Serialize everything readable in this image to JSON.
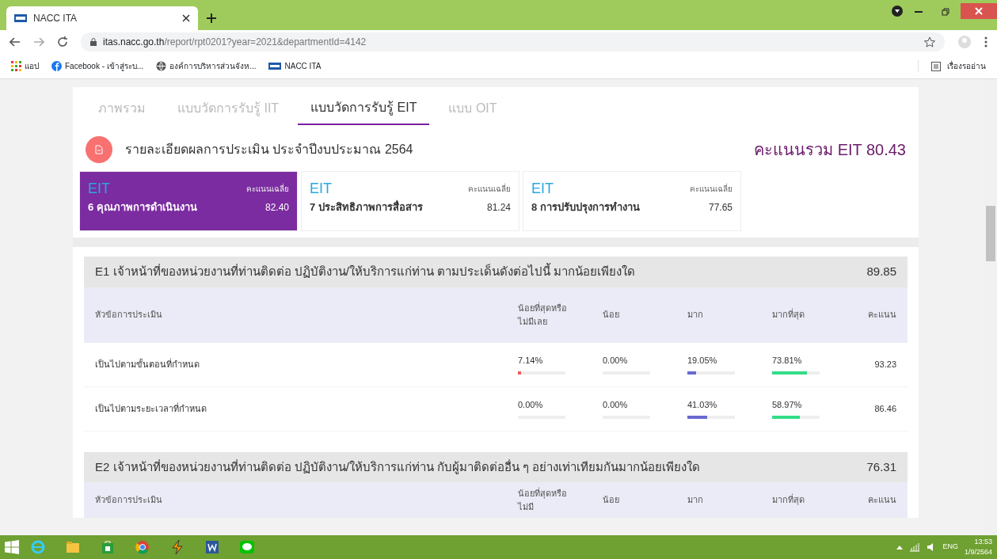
{
  "browser": {
    "tab_title": "NACC ITA",
    "url_host": "itas.nacc.go.th",
    "url_path": "/report/rpt0201?year=2021&departmentId=4142",
    "bookmarks": [
      {
        "kind": "apps",
        "label": "แอป"
      },
      {
        "kind": "facebook",
        "label": "Facebook - เข้าสู่ระบ..."
      },
      {
        "kind": "globe",
        "label": "องค์การบริหารส่วนจังห..."
      },
      {
        "kind": "ita",
        "label": "NACC ITA"
      }
    ],
    "reading_list": "เรื่องรออ่าน"
  },
  "tabs": [
    {
      "label": "ภาพรวม",
      "selected": false
    },
    {
      "label": "แบบวัดการรับรู้ IIT",
      "selected": false
    },
    {
      "label": "แบบวัดการรับรู้ EIT",
      "selected": true
    },
    {
      "label": "แบบ OIT",
      "selected": false
    }
  ],
  "header": {
    "title": "รายละเอียดผลการประเมิน ประจำปีงบประมาณ 2564",
    "total": "คะแนนรวม EIT 80.43"
  },
  "cards": [
    {
      "code": "EIT",
      "avg_label": "คะแนนเฉลี่ย",
      "name": "6 คุณภาพการดำเนินงาน",
      "score": "82.40",
      "selected": true
    },
    {
      "code": "EIT",
      "avg_label": "คะแนนเฉลี่ย",
      "name": "7 ประสิทธิภาพการสื่อสาร",
      "score": "81.24",
      "selected": false
    },
    {
      "code": "EIT",
      "avg_label": "คะแนนเฉลี่ย",
      "name": "8 การปรับปรุงการทำงาน",
      "score": "77.65",
      "selected": false
    }
  ],
  "sections": [
    {
      "title": "E1 เจ้าหน้าที่ของหน่วยงานที่ท่านติดต่อ ปฏิบัติงาน/ให้บริการแก่ท่าน ตามประเด็นดังต่อไปนี้ มากน้อยเพียงใด",
      "score": "89.85",
      "topic_header": "หัวข้อการประเมิน",
      "level_headers": [
        "น้อยที่สุดหรือไม่มีเลย",
        "น้อย",
        "มาก",
        "มากที่สุด"
      ],
      "score_header": "คะแนน",
      "rows": [
        {
          "label": "เป็นไปตามขั้นตอนที่กำหนด",
          "cells": [
            {
              "value": "7.14%",
              "level": 0.0714,
              "color": "#f05a5a"
            },
            {
              "value": "0.00%"
            },
            {
              "value": "19.05%",
              "level": 0.1905,
              "color": "#6a6ad0"
            },
            {
              "value": "73.81%",
              "level": 0.7381,
              "color": "#33dd88"
            }
          ],
          "score": "93.23"
        },
        {
          "label": "เป็นไปตามระยะเวลาที่กำหนด",
          "cells": [
            {
              "value": "0.00%"
            },
            {
              "value": "0.00%"
            },
            {
              "value": "41.03%",
              "level": 0.4103,
              "color": "#6a6ad0"
            },
            {
              "value": "58.97%",
              "level": 0.5897,
              "color": "#33dd88"
            }
          ],
          "score": "86.46"
        }
      ]
    },
    {
      "title": "E2 เจ้าหน้าที่ของหน่วยงานที่ท่านติดต่อ ปฏิบัติงาน/ให้บริการแก่ท่าน กับผู้มาติดต่ออื่น ๆ อย่างเท่าเทียมกันมากน้อยเพียงใด",
      "score": "76.31",
      "topic_header": "หัวข้อการประเมิน",
      "level_headers": [
        "น้อยที่สุดหรือไม่มี",
        "น้อย",
        "มาก",
        "มากที่สุด"
      ],
      "score_header": "คะแนน"
    }
  ],
  "taskbar": {
    "language": "ENG",
    "time": "13:53",
    "date": "1/9/2564"
  }
}
